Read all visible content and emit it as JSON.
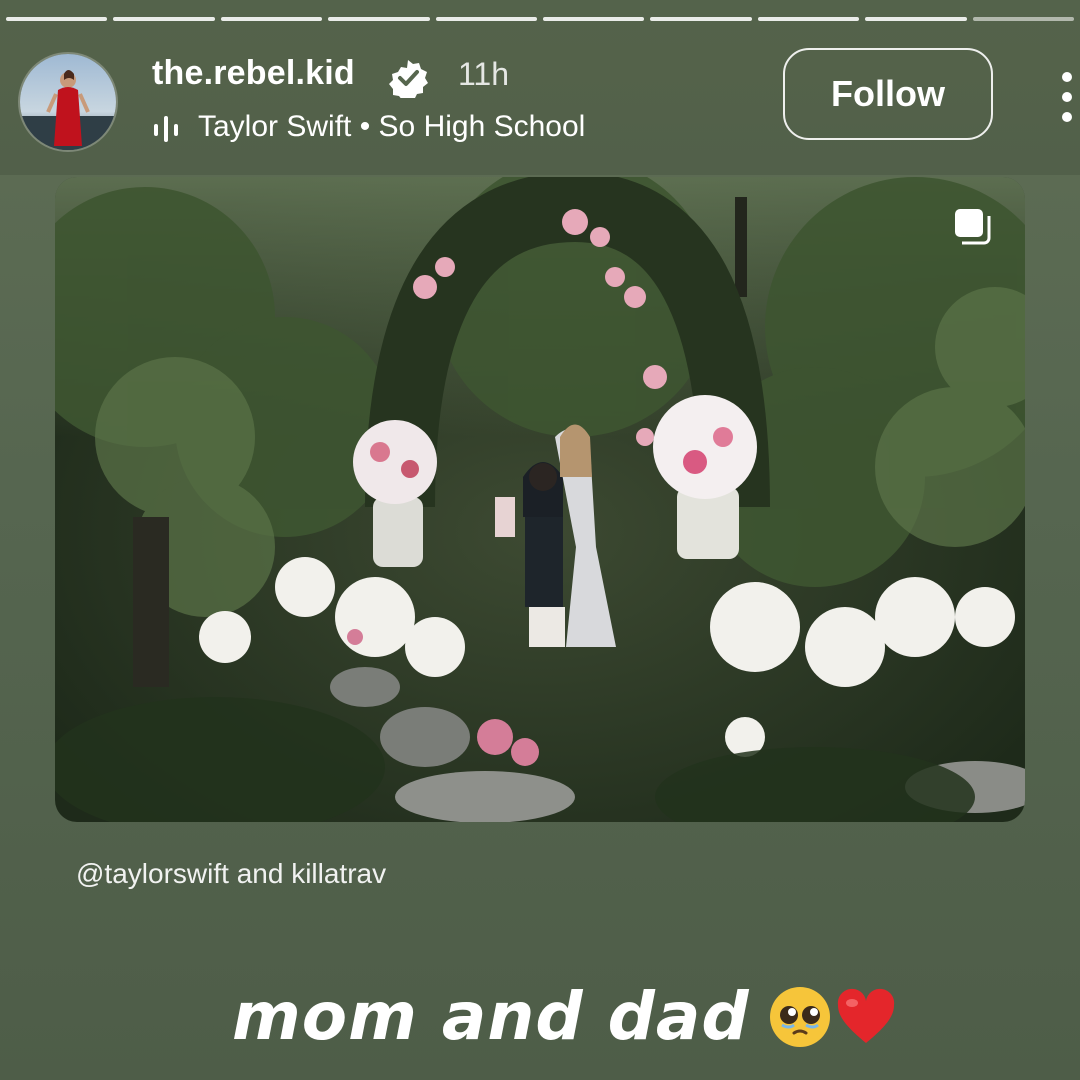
{
  "story": {
    "segments": 10,
    "current_segment": 9
  },
  "header": {
    "username": "the.rebel.kid",
    "time_ago": "11h",
    "music": "Taylor Swift • So High School",
    "follow_label": "Follow"
  },
  "post": {
    "mention_user": "@taylorswift",
    "mention_connector": "and",
    "mention_second": "killatrav"
  },
  "caption": {
    "text": "mom and dad"
  },
  "icons": {
    "verified": "verified-badge-icon",
    "music": "music-bars-icon",
    "more": "more-vertical-icon",
    "multi": "multi-photo-icon"
  },
  "colors": {
    "background": "#5b6a52",
    "text": "#ffffff"
  }
}
